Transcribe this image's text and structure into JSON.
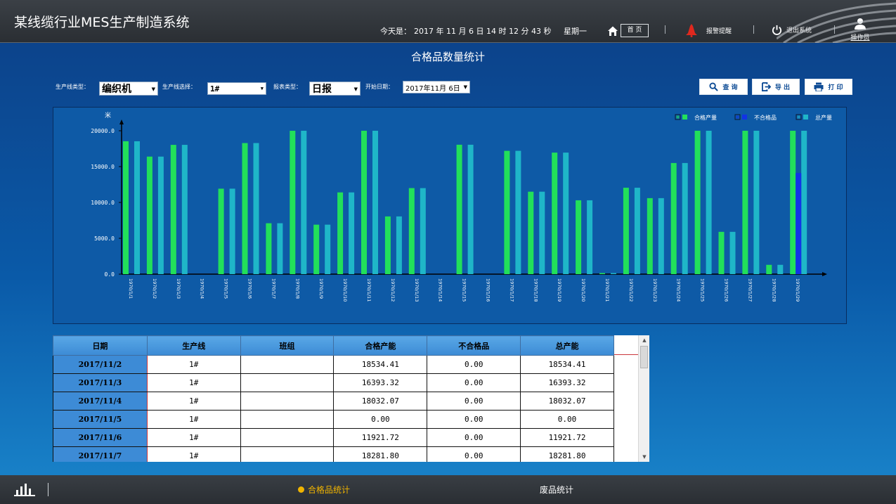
{
  "header": {
    "app_title": "某线缆行业MES生产制造系统",
    "today_label": "今天是：",
    "today_value": "2017 年 11 月 6 日  14 时 12 分 43 秒",
    "weekday": "星期一",
    "home_label": "首 页",
    "alarm_label": "报警提醒",
    "exit_label": "退出系统",
    "user_label": "操作员"
  },
  "page_title": "合格品数量统计",
  "filters": {
    "line_type_label": "生产线类型：",
    "line_type_value": "编织机",
    "line_select_label": "生产线选择：",
    "line_select_value": "1#",
    "report_type_label": "报表类型：",
    "report_type_value": "日报",
    "start_date_label": "开始日期：",
    "start_date_value": "2017年11月 6日"
  },
  "actions": {
    "query": "查 询",
    "export": "导 出",
    "print": "打 印"
  },
  "chart_data": {
    "type": "bar",
    "ylabel": "米",
    "ylim": [
      0,
      20000
    ],
    "yticks": [
      "20000.0",
      "15000.0",
      "10000.0",
      "5000.0",
      "0.0"
    ],
    "legend_position": "top-right",
    "categories": [
      "1970/1/1",
      "1970/1/2",
      "1970/1/3",
      "1970/1/4",
      "1970/1/5",
      "1970/1/6",
      "1970/1/7",
      "1970/1/8",
      "1970/1/9",
      "1970/1/10",
      "1970/1/11",
      "1970/1/12",
      "1970/1/13",
      "1970/1/14",
      "1970/1/15",
      "1970/1/16",
      "1970/1/17",
      "1970/1/18",
      "1970/1/19",
      "1970/1/20",
      "1970/1/21",
      "1970/1/22",
      "1970/1/23",
      "1970/1/24",
      "1970/1/25",
      "1970/1/26",
      "1970/1/27",
      "1970/1/28",
      "1970/1/29"
    ],
    "series": [
      {
        "name": "合格产量",
        "color": "#22e05a",
        "values": [
          18534.41,
          16393.32,
          18032.07,
          0,
          11921.72,
          18281.8,
          7100,
          20000,
          6900,
          11400,
          20000,
          8050,
          12000,
          0,
          18050,
          0,
          17200,
          11500,
          16950,
          10300,
          150,
          12050,
          10600,
          15500,
          20000,
          5900,
          20000,
          1300,
          20000
        ]
      },
      {
        "name": "不合格品",
        "color": "#1133e6",
        "values": [
          0,
          0,
          0,
          0,
          0,
          0,
          0,
          0,
          0,
          0,
          0,
          0,
          0,
          0,
          0,
          0,
          0,
          0,
          0,
          0,
          0,
          0,
          0,
          0,
          0,
          0,
          0,
          0,
          14100
        ]
      },
      {
        "name": "总产量",
        "color": "#1fb6c8",
        "values": [
          18534.41,
          16393.32,
          18032.07,
          0,
          11921.72,
          18281.8,
          7100,
          20000,
          6900,
          11400,
          20000,
          8050,
          12000,
          0,
          18050,
          0,
          17200,
          11500,
          16950,
          10300,
          150,
          12050,
          10600,
          15500,
          20000,
          5900,
          20000,
          1300,
          20000
        ]
      }
    ]
  },
  "table": {
    "headers": [
      "日期",
      "生产线",
      "班组",
      "合格产能",
      "不合格品",
      "总产能"
    ],
    "rows": [
      [
        "2017/11/2",
        "1#",
        "",
        "18534.41",
        "0.00",
        "18534.41"
      ],
      [
        "2017/11/3",
        "1#",
        "",
        "16393.32",
        "0.00",
        "16393.32"
      ],
      [
        "2017/11/4",
        "1#",
        "",
        "18032.07",
        "0.00",
        "18032.07"
      ],
      [
        "2017/11/5",
        "1#",
        "",
        "0.00",
        "0.00",
        "0.00"
      ],
      [
        "2017/11/6",
        "1#",
        "",
        "11921.72",
        "0.00",
        "11921.72"
      ],
      [
        "2017/11/7",
        "1#",
        "",
        "18281.80",
        "0.00",
        "18281.80"
      ]
    ]
  },
  "footer": {
    "tab_pass": "合格品统计",
    "tab_scrap": "废品统计"
  }
}
